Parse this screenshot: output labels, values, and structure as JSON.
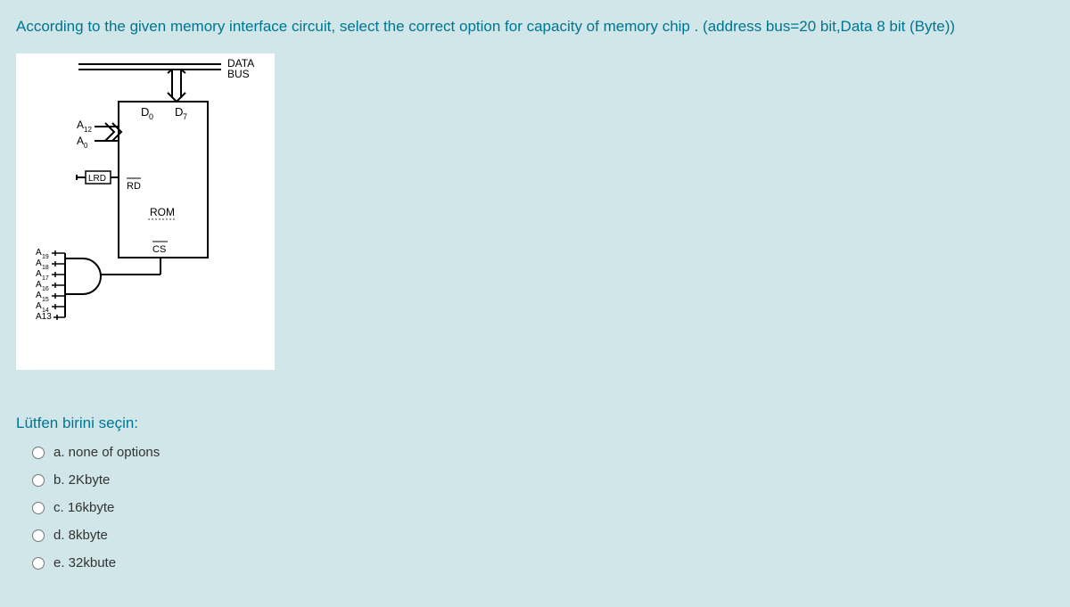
{
  "question": "According to the given memory interface circuit, select the correct option for  capacity of memory chip . (address bus=20 bit,Data 8 bit (Byte))",
  "diagram": {
    "data_bus": "DATA\nBUS",
    "d0": "D",
    "d0_sub": "0",
    "d7": "D",
    "d7_sub": "7",
    "a12": "A",
    "a12_sub": "12",
    "a0": "A",
    "a0_sub": "0",
    "lrd": "LRD",
    "rd": "RD",
    "rom": "ROM",
    "cs": "CS",
    "addr_lines": [
      {
        "label": "A",
        "sub": "19"
      },
      {
        "label": "A",
        "sub": "18"
      },
      {
        "label": "A",
        "sub": "17"
      },
      {
        "label": "A",
        "sub": "16"
      },
      {
        "label": "A",
        "sub": "15"
      },
      {
        "label": "A",
        "sub": "14"
      },
      {
        "label": "A13",
        "sub": ""
      }
    ]
  },
  "prompt": "Lütfen birini seçin:",
  "options": [
    {
      "key": "a",
      "text": "a. none of options"
    },
    {
      "key": "b",
      "text": "b. 2Kbyte"
    },
    {
      "key": "c",
      "text": "c. 16kbyte"
    },
    {
      "key": "d",
      "text": "d. 8kbyte"
    },
    {
      "key": "e",
      "text": "e. 32kbute"
    }
  ]
}
